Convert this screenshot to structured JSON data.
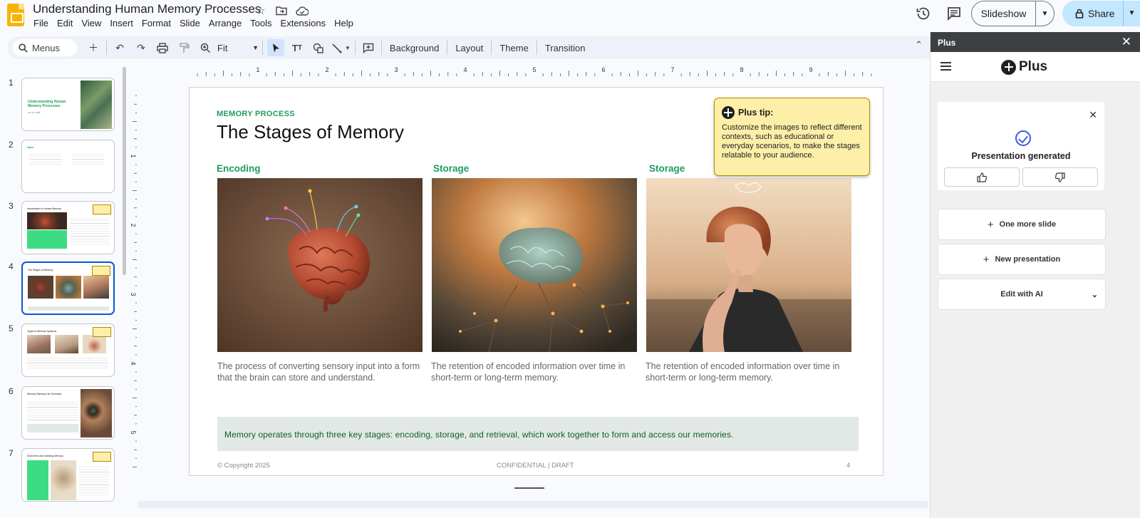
{
  "app": {
    "title": "Understanding Human Memory Processes",
    "menu": [
      "File",
      "Edit",
      "View",
      "Insert",
      "Format",
      "Slide",
      "Arrange",
      "Tools",
      "Extensions",
      "Help"
    ],
    "slideshow_label": "Slideshow",
    "share_label": "Share"
  },
  "toolbar": {
    "search_placeholder": "Menus",
    "zoom": "Fit",
    "background": "Background",
    "layout": "Layout",
    "theme": "Theme",
    "transition": "Transition"
  },
  "ruler": {
    "h_labels": [
      "1",
      "2",
      "3",
      "4",
      "5",
      "6",
      "7",
      "8",
      "9"
    ],
    "v_labels": [
      "1",
      "2",
      "3",
      "4",
      "5"
    ]
  },
  "filmstrip": [
    {
      "num": "1",
      "title": "Understanding Human Memory Processes",
      "date": "Jan 23, 2025"
    },
    {
      "num": "2",
      "title": "Index"
    },
    {
      "num": "3",
      "title": "Introduction to Human Memory"
    },
    {
      "num": "4",
      "title": "The Stages of Memory"
    },
    {
      "num": "5",
      "title": "Types of Memory Systems"
    },
    {
      "num": "6",
      "title": "Sensory Memory: An Overview"
    },
    {
      "num": "7",
      "title": "Short-term and Working Memory"
    }
  ],
  "slide": {
    "kicker": "MEMORY PROCESS",
    "title": "The Stages of Memory",
    "columns": [
      {
        "heading": "Encoding",
        "caption": "The process of converting sensory input into a form that the brain can store and understand."
      },
      {
        "heading": "Storage",
        "caption": "The retention of encoded information over time in short-term or long-term memory."
      },
      {
        "heading": "Storage",
        "caption": "The retention of encoded information over time in short-term or long-term memory."
      }
    ],
    "summary": "Memory operates through three key stages: encoding, storage, and retrieval, which work together to form and access our memories.",
    "footer_left": "© Copyright 2025",
    "footer_center": "CONFIDENTIAL  |  DRAFT",
    "footer_right": "4"
  },
  "tip": {
    "heading": "Plus tip:",
    "body": "Customize the images to reflect different contexts, such as educational or everyday scenarios, to make the stages relatable to your audience."
  },
  "sidepanel": {
    "header": "Plus",
    "brand": "Plus",
    "status": "Presentation generated",
    "one_more": "One more slide",
    "new_presentation": "New presentation",
    "edit_ai": "Edit with AI"
  }
}
